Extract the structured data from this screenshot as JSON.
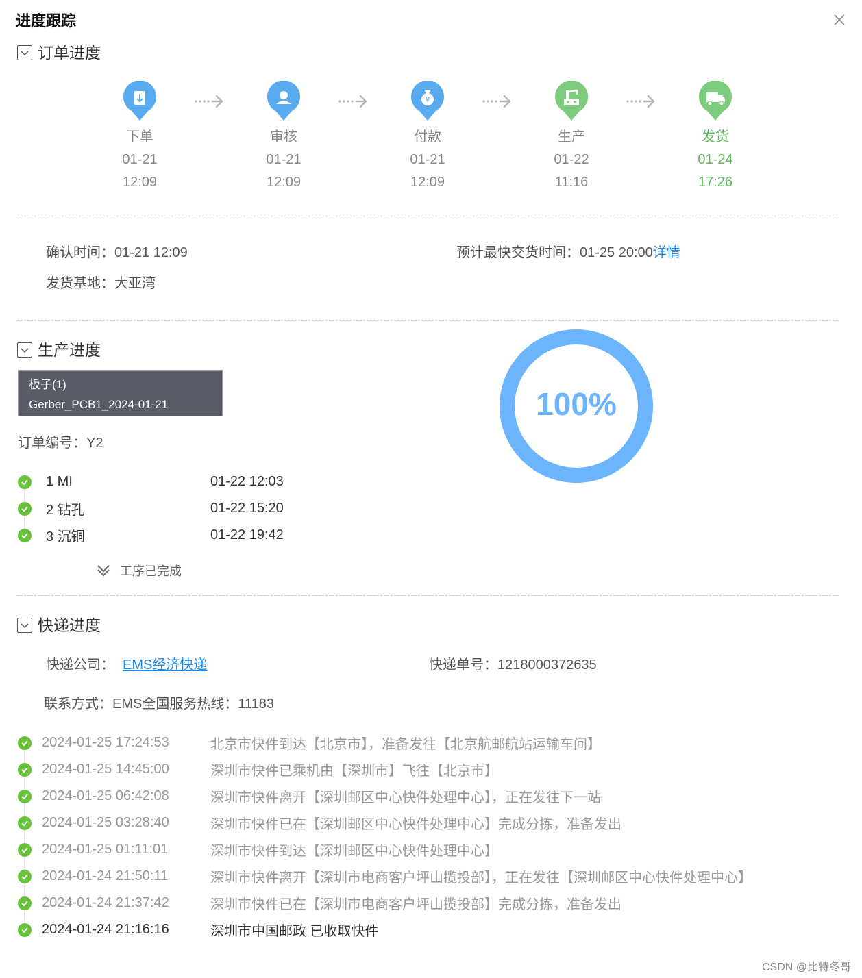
{
  "dialog": {
    "title": "进度跟踪",
    "close_icon": "close-icon"
  },
  "order_progress": {
    "title": "订单进度",
    "steps": [
      {
        "label": "下单",
        "date": "01-21",
        "time": "12:09",
        "icon": "document-icon",
        "color": "#5aaaf0"
      },
      {
        "label": "审核",
        "date": "01-21",
        "time": "12:09",
        "icon": "user-icon",
        "color": "#5aaaf0"
      },
      {
        "label": "付款",
        "date": "01-21",
        "time": "12:09",
        "icon": "money-bag-icon",
        "color": "#5aaaf0"
      },
      {
        "label": "生产",
        "date": "01-22",
        "time": "11:16",
        "icon": "factory-icon",
        "color": "#7dcb7d"
      },
      {
        "label": "发货",
        "date": "01-24",
        "time": "17:26",
        "icon": "truck-icon",
        "color": "#7dcb7d"
      }
    ],
    "confirm_time": "确认时间：01-21 12:09",
    "ship_base": "发货基地：大亚湾",
    "expected_delivery": "预计最快交货时间：01-25 20:00",
    "details_link": "详情"
  },
  "production_progress": {
    "title": "生产进度",
    "board_name": "板子(1)",
    "board_file": "Gerber_PCB1_2024-01-21",
    "order_no": "订单编号：Y2",
    "percent_label": "100%",
    "percent": 100,
    "processes": [
      {
        "name": "1 MI",
        "time": "01-22 12:03"
      },
      {
        "name": "2 钻孔",
        "time": "01-22 15:20"
      },
      {
        "name": "3 沉铜",
        "time": "01-22 19:42"
      }
    ],
    "completed_text": "工序已完成"
  },
  "express_progress": {
    "title": "快递进度",
    "company_label": "快递公司：",
    "company_name": "EMS经济快递",
    "tracking_no": "快递单号：1218000372635",
    "contact": "联系方式：EMS全国服务热线：11183",
    "events": [
      {
        "time": "2024-01-25 17:24:53",
        "text": "北京市快件到达【北京市】，准备发往【北京航邮航站运输车间】"
      },
      {
        "time": "2024-01-25 14:45:00",
        "text": "深圳市快件已乘机由【深圳市】飞往【北京市】"
      },
      {
        "time": "2024-01-25 06:42:08",
        "text": "深圳市快件离开【深圳邮区中心快件处理中心】，正在发往下一站"
      },
      {
        "time": "2024-01-25 03:28:40",
        "text": "深圳市快件已在【深圳邮区中心快件处理中心】完成分拣，准备发出"
      },
      {
        "time": "2024-01-25 01:11:01",
        "text": "深圳市快件到达【深圳邮区中心快件处理中心】"
      },
      {
        "time": "2024-01-24 21:50:11",
        "text": "深圳市快件离开【深圳市电商客户坪山揽投部】，正在发往【深圳邮区中心快件处理中心】"
      },
      {
        "time": "2024-01-24 21:37:42",
        "text": "深圳市快件已在【深圳市电商客户坪山揽投部】完成分拣，准备发出"
      },
      {
        "time": "2024-01-24 21:16:16",
        "text": "深圳市中国邮政 已收取快件"
      }
    ]
  },
  "watermark": "CSDN @比特冬哥",
  "colors": {
    "accent": "#1e88e5",
    "success": "#67c23a",
    "ring": "#6cb4fb",
    "pending_step": "#5aaaf0",
    "done_step": "#7dcb7d"
  }
}
